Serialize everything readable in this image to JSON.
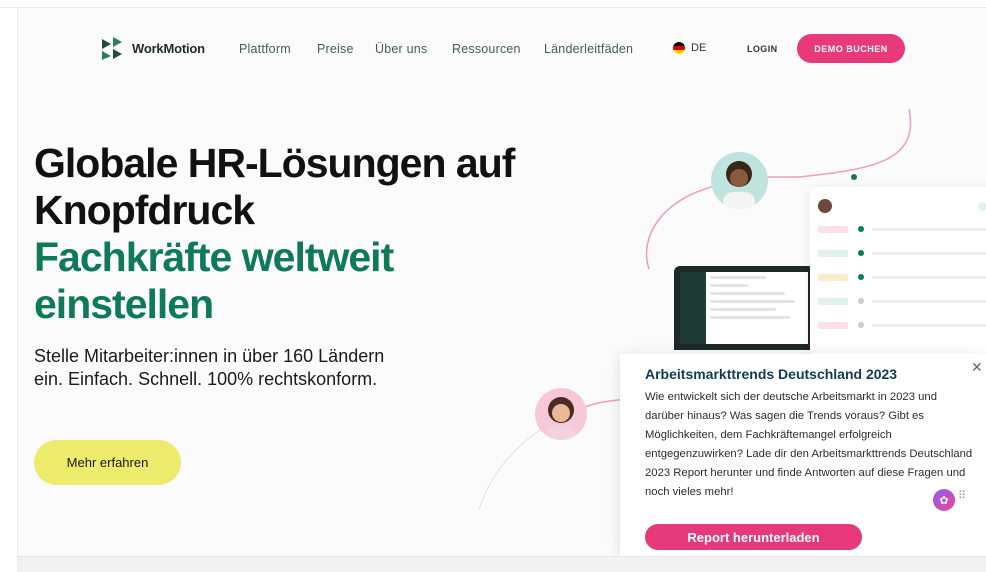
{
  "header": {
    "logo_text": "WorkMotion",
    "nav": [
      "Plattform",
      "Preise",
      "Über uns",
      "Ressourcen",
      "Länderleitfäden"
    ],
    "language": "DE",
    "login": "LOGIN",
    "demo_button": "DEMO BUCHEN"
  },
  "hero": {
    "title_line1": "Globale HR-Lösungen auf",
    "title_line2": "Knopfdruck",
    "subtitle_line1": "Fachkräfte weltweit",
    "subtitle_line2": "einstellen",
    "description": "Stelle Mitarbeiter:innen in über 160 Ländern ein. Einfach. Schnell. 100% rechtskonform.",
    "cta": "Mehr erfahren"
  },
  "popup": {
    "close_icon": "close-icon",
    "title": "Arbeitsmarkttrends Deutschland 2023",
    "body": "Wie entwickelt sich der deutsche Arbeitsmarkt in 2023 und darüber hinaus? Was sagen die Trends voraus? Gibt es Möglichkeiten, dem Fachkräftemangel erfolgreich entgegenzuwirken? Lade dir den Arbeitsmarkttrends Deutschland 2023 Report herunter und finde Antworten auf diese Fragen und noch vieles mehr!",
    "button": "Report herunterladen"
  },
  "colors": {
    "brand_green": "#0e7a5a",
    "accent_pink": "#e8397b",
    "cta_yellow": "#eceb6b",
    "popup_title": "#0f3b54"
  }
}
